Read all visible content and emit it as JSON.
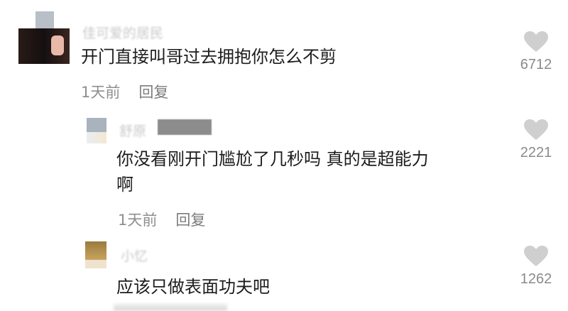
{
  "comments": [
    {
      "username": "佳可爱的居民",
      "text": "开门直接叫哥过去拥抱你怎么不剪",
      "time": "1天前",
      "reply_label": "回复",
      "likes": "6712"
    },
    {
      "username": "舒原",
      "text_line1": "你没看刚开门尴尬了几秒吗 真的是超能力",
      "text_line2": "啊",
      "time": "1天前",
      "reply_label": "回复",
      "likes": "2221"
    },
    {
      "username": "小忆",
      "text": "应该只做表面功夫吧",
      "likes": "1262"
    }
  ],
  "icons": {
    "like": "heart-icon"
  },
  "colors": {
    "text": "#1c1c1c",
    "meta": "#8f8f8f",
    "heart": "#cfcfcf"
  }
}
